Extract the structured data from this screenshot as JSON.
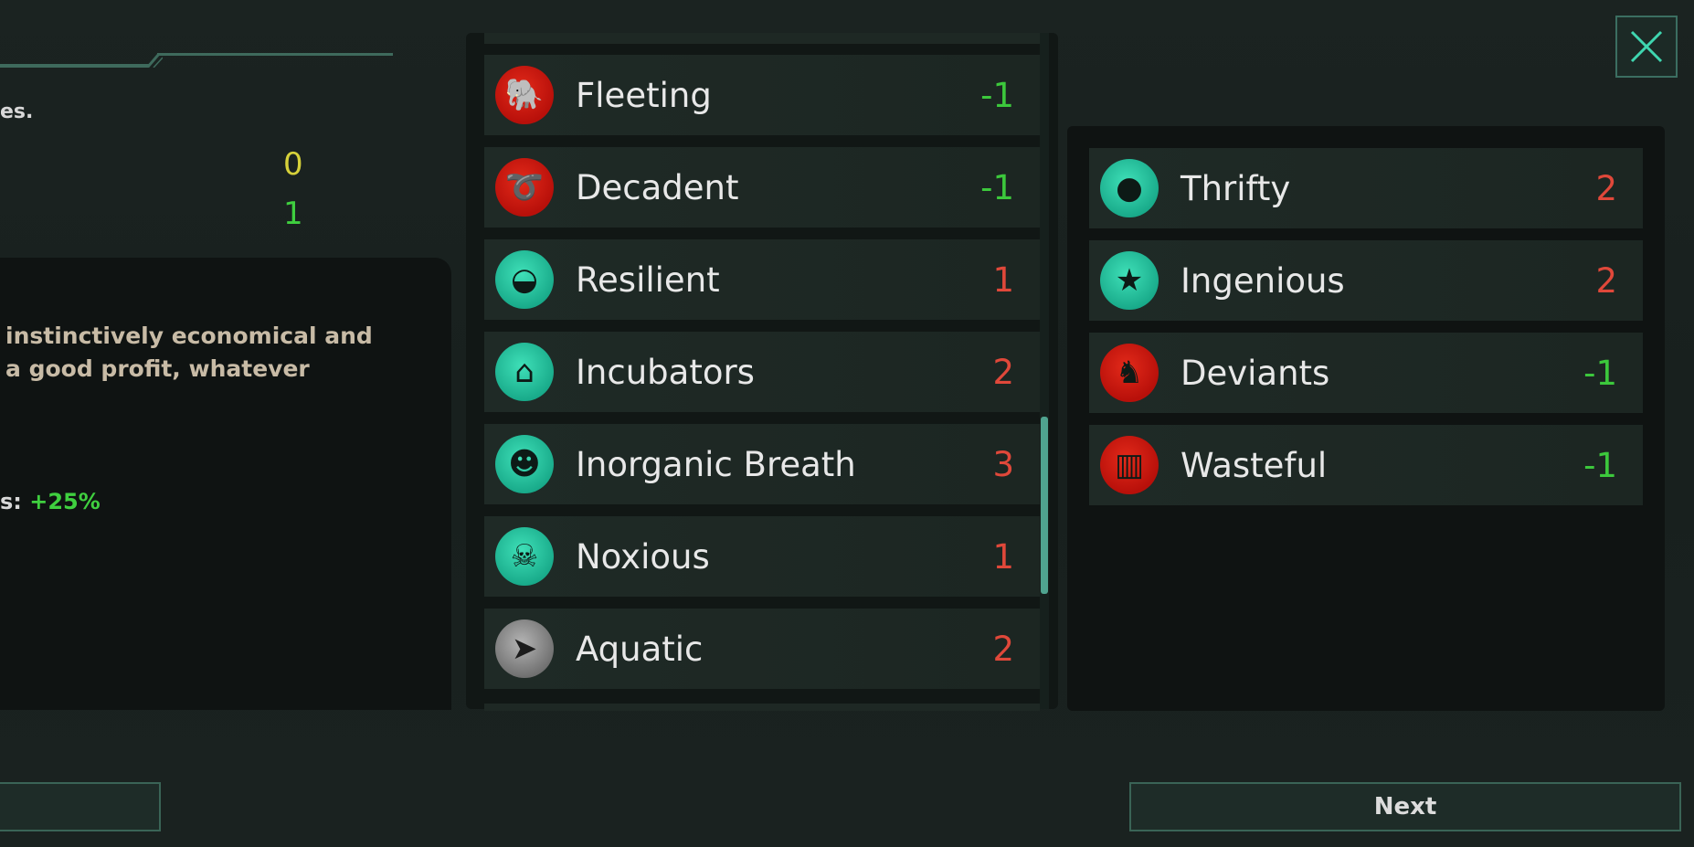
{
  "left_panel": {
    "desc_fragment": "es.",
    "values": [
      "0",
      "1"
    ],
    "value_colors": [
      "#d6d13a",
      "#3fcf3f"
    ],
    "trait_desc_lines": [
      "instinctively economical and",
      "a good profit, whatever"
    ],
    "stat_label_fragment": "s:",
    "stat_value": "+25%"
  },
  "available_traits": [
    {
      "name": "Fleeting",
      "cost": "-1",
      "icon": "elephant-icon",
      "icon_color": "red",
      "cost_type": "neg"
    },
    {
      "name": "Decadent",
      "cost": "-1",
      "icon": "whip-icon",
      "icon_color": "red",
      "cost_type": "neg"
    },
    {
      "name": "Resilient",
      "cost": "1",
      "icon": "armadillo-icon",
      "icon_color": "teal",
      "cost_type": "pos"
    },
    {
      "name": "Incubators",
      "cost": "2",
      "icon": "incubator-icon",
      "icon_color": "teal",
      "cost_type": "pos"
    },
    {
      "name": "Inorganic Breath",
      "cost": "3",
      "icon": "breath-silhouette-icon",
      "icon_color": "teal",
      "cost_type": "pos"
    },
    {
      "name": "Noxious",
      "cost": "1",
      "icon": "toxic-skull-icon",
      "icon_color": "teal",
      "cost_type": "pos"
    },
    {
      "name": "Aquatic",
      "cost": "2",
      "icon": "fish-icon",
      "icon_color": "gray",
      "cost_type": "pos"
    }
  ],
  "selected_traits": [
    {
      "name": "Thrifty",
      "cost": "2",
      "icon": "piggy-bank-icon",
      "icon_color": "teal",
      "cost_type": "pos"
    },
    {
      "name": "Ingenious",
      "cost": "2",
      "icon": "people-star-icon",
      "icon_color": "teal",
      "cost_type": "pos"
    },
    {
      "name": "Deviants",
      "cost": "-1",
      "icon": "duck-icon",
      "icon_color": "red",
      "cost_type": "neg"
    },
    {
      "name": "Wasteful",
      "cost": "-1",
      "icon": "trash-icon",
      "icon_color": "red",
      "cost_type": "neg"
    }
  ],
  "buttons": {
    "next": "Next",
    "back": "",
    "close_icon": "close-icon"
  },
  "colors": {
    "accent": "#4fa38f",
    "positive_cost": "#e0483a",
    "negative_cost": "#3cc83c"
  },
  "scroll": {
    "position_fraction": 0.6,
    "visible_fraction": 0.26
  }
}
